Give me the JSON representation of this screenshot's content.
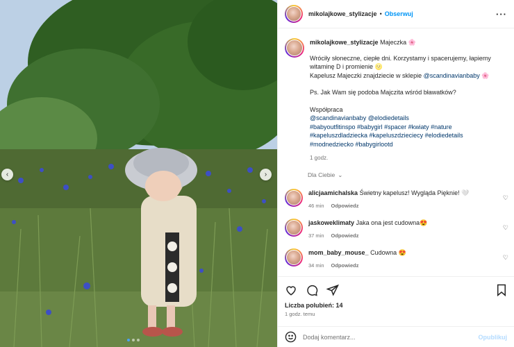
{
  "post": {
    "username": "mikolajkowe_stylizacje",
    "follow_label": "Obserwuj",
    "separator": "•",
    "more_icon": "more-horizontal-icon"
  },
  "caption": {
    "username": "mikolajkowe_stylizacje",
    "title": "Majeczka 🌸",
    "line1": "Wróciły słoneczne, ciepłe dni. Korzystamy i spacerujemy, łapiemy witaminę D i promienie 🌝",
    "line2_prefix": "Kapelusz Majeczki znajdziecie w sklepie",
    "line2_link": "@scandinavianbaby",
    "line2_suffix": "🌸",
    "line3": "Ps. Jak Wam się podoba Majczita wśród bławatków?",
    "line4": "Współpraca",
    "mentions": "@scandinavianbaby @elodiedetails",
    "hashtags": "#babyoutfitinspo #babygirl #spacer #kwiaty #nature #kapeluszdladziecka #kapeluszdzieciecy #elodiedetails #modnedziecko #babygirlootd",
    "time": "1 godz."
  },
  "replies_toggle": "Dla Ciebie",
  "comments": [
    {
      "username": "alicjaamichalska",
      "text": "Świetny kapelusz! Wygląda Pięknie! 🤍",
      "time": "46 min",
      "reply": "Odpowiedz"
    },
    {
      "username": "jaskoweklimaty",
      "text": "Jaka ona jest cudowna😍",
      "time": "37 min",
      "reply": "Odpowiedz"
    },
    {
      "username": "mom_baby_mouse_",
      "text": "Cudowna 😍",
      "time": "34 min",
      "reply": "Odpowiedz"
    }
  ],
  "likes": {
    "label": "Liczba polubień:",
    "count": "14"
  },
  "posted_time": "1 godz. temu",
  "composer": {
    "placeholder": "Dodaj komentarz...",
    "post_label": "Opublikuj"
  },
  "colors": {
    "accent": "#0095f6",
    "link": "#00376b",
    "muted": "#737373"
  }
}
